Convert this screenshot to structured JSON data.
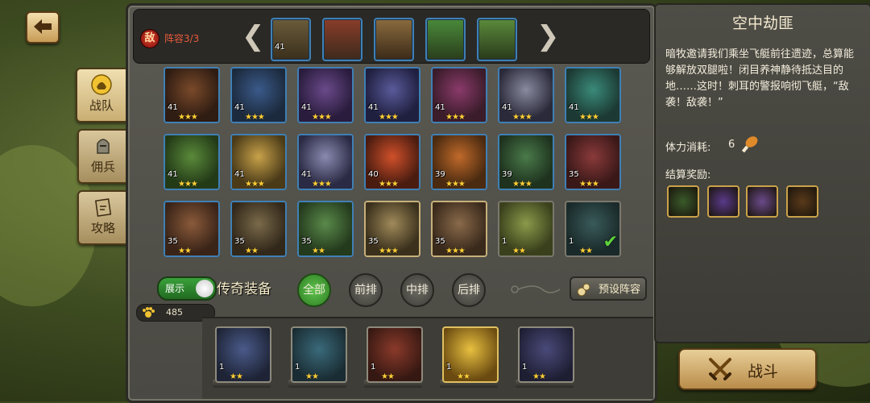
{
  "nav": {
    "back_icon": "back-arrow-icon",
    "tabs": [
      {
        "label": "战队",
        "icon": "helmet-icon",
        "active": true
      },
      {
        "label": "佣兵",
        "icon": "knight-helmet-icon",
        "active": false
      },
      {
        "label": "攻略",
        "icon": "guide-book-icon",
        "active": false
      }
    ]
  },
  "enemy": {
    "badge": "敌",
    "lineup_label": "阵容3/3",
    "levels": [
      "41",
      "",
      "",
      "",
      ""
    ],
    "prev_arrow": "❮",
    "next_arrow": "❯"
  },
  "roster": {
    "rows": [
      [
        {
          "level": "41",
          "stars": "★★★"
        },
        {
          "level": "41",
          "stars": "★★★"
        },
        {
          "level": "41",
          "stars": "★★★"
        },
        {
          "level": "41",
          "stars": "★★★"
        },
        {
          "level": "41",
          "stars": "★★★"
        },
        {
          "level": "41",
          "stars": "★★★"
        },
        {
          "level": "41",
          "stars": "★★★"
        }
      ],
      [
        {
          "level": "41",
          "stars": "★★★"
        },
        {
          "level": "41",
          "stars": "★★★"
        },
        {
          "level": "41",
          "stars": "★★★"
        },
        {
          "level": "40",
          "stars": "★★★"
        },
        {
          "level": "39",
          "stars": "★★★"
        },
        {
          "level": "39",
          "stars": "★★★"
        },
        {
          "level": "35",
          "stars": "★★★"
        }
      ],
      [
        {
          "level": "35",
          "stars": "★★"
        },
        {
          "level": "35",
          "stars": "★★"
        },
        {
          "level": "35",
          "stars": "★★"
        },
        {
          "level": "35",
          "stars": "★★★"
        },
        {
          "level": "35",
          "stars": "★★★"
        },
        {
          "level": "1",
          "stars": "★★"
        },
        {
          "level": "1",
          "stars": "★★"
        }
      ]
    ],
    "check_mark": "✔"
  },
  "controls": {
    "toggle_label": "展示",
    "legend_label": "传奇装备",
    "filters": [
      "全部",
      "前排",
      "中排",
      "后排"
    ],
    "preset_label": "预设阵容"
  },
  "power": {
    "value": "485"
  },
  "bench": [
    {
      "level": "1",
      "stars": "★★"
    },
    {
      "level": "1",
      "stars": "★★"
    },
    {
      "level": "1",
      "stars": "★★"
    },
    {
      "level": "1",
      "stars": "★★"
    },
    {
      "level": "1",
      "stars": "★★"
    }
  ],
  "stage": {
    "title": "空中劫匪",
    "description": "暗牧邀请我们乘坐飞艇前往遗迹，总算能够解放双腿啦！闭目养神静待抵达目的地……这时！刺耳的警报响彻飞艇，“敌袭！敌袭！”",
    "stamina_label": "体力消耗:",
    "stamina_value": "6",
    "reward_label": "结算奖励:",
    "rewards": [
      "staff-icon",
      "scroll-icon",
      "scroll-icon",
      "boots-icon"
    ]
  },
  "fight": {
    "label": "战斗"
  },
  "colors": {
    "frame_blue": "#3f80b5",
    "frame_gold": "#c7b07a",
    "filter_active": "#3fa52f",
    "star": "#ffcf36"
  }
}
